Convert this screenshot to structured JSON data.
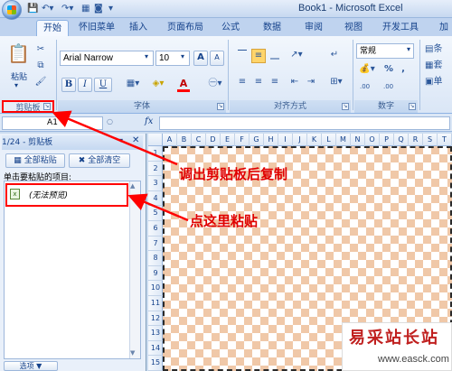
{
  "title": "Book1 - Microsoft Excel",
  "tabs": [
    "开始",
    "怀旧菜单",
    "插入",
    "页面布局",
    "公式",
    "数据",
    "审阅",
    "视图",
    "开发工具",
    "加"
  ],
  "ribbon": {
    "clipboard": {
      "label": "剪贴板",
      "paste": "粘贴"
    },
    "font": {
      "label": "字体",
      "font_name": "Arial Narrow",
      "font_size": "10",
      "bold": "B",
      "italic": "I",
      "underline": "U",
      "grow": "A",
      "shrink": "A",
      "font_color_letter": "A"
    },
    "alignment": {
      "label": "对齐方式"
    },
    "number": {
      "label": "数字",
      "format": "常规",
      "percent": "%",
      "comma": ",",
      "inc_decimal": ".00",
      "dec_decimal": ".00"
    },
    "styles": {
      "items": [
        "条",
        "套",
        "单"
      ]
    }
  },
  "formula_bar": {
    "name_box": "A1",
    "fx": "fx"
  },
  "clipboard_pane": {
    "title": "1/24 - 剪贴板",
    "paste_all": "全部粘贴",
    "clear_all": "全部清空",
    "hint": "单击要粘贴的项目:",
    "item_text": "(无法预览)",
    "options": "选项 ▼"
  },
  "sheet": {
    "columns": [
      "A",
      "B",
      "C",
      "D",
      "E",
      "F",
      "G",
      "H",
      "I",
      "J",
      "K",
      "L",
      "M",
      "N",
      "O",
      "P",
      "Q",
      "R",
      "S",
      "T"
    ],
    "rows": [
      "1",
      "2",
      "3",
      "4",
      "5",
      "6",
      "7",
      "8",
      "9",
      "10",
      "11",
      "12",
      "13",
      "14",
      "15"
    ]
  },
  "annotations": {
    "copy_note": "调出剪贴板后复制",
    "paste_note": "点这里粘贴"
  },
  "watermark": {
    "name": "易采站长站",
    "url": "www.easck.com"
  },
  "colors": {
    "callout": "#e00000",
    "checker": "#f0c8a8"
  }
}
